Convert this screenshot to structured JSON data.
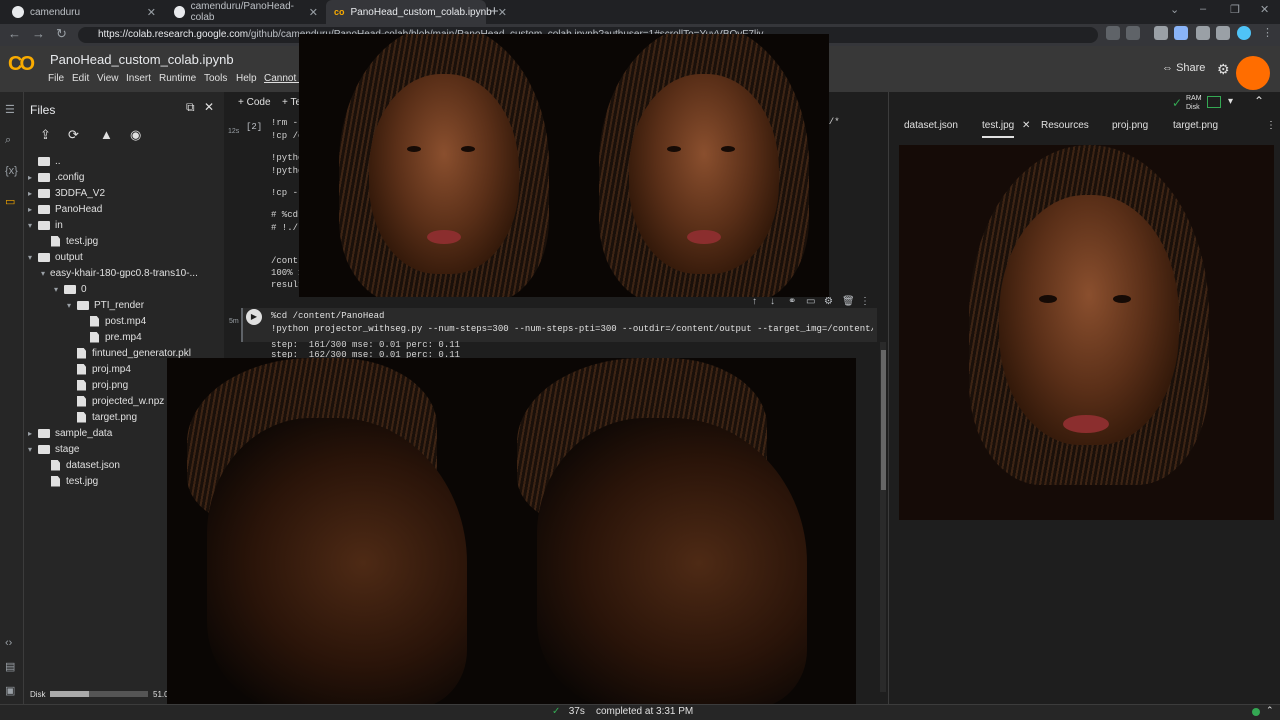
{
  "browser": {
    "tabs": [
      {
        "label": "camenduru"
      },
      {
        "label": "camenduru/PanoHead-colab"
      },
      {
        "label": "PanoHead_custom_colab.ipynb"
      }
    ],
    "url_host": "https://colab.research.google.com",
    "url_path": "/github/camenduru/PanoHead-colab/blob/main/PanoHead_custom_colab.ipynb?authuser=1#scrollTo=YuvVBOvF7liv"
  },
  "colab": {
    "title": "PanoHead_custom_colab.ipynb",
    "menu": [
      "File",
      "Edit",
      "View",
      "Insert",
      "Runtime",
      "Tools",
      "Help",
      "Cannot save changes"
    ],
    "share_label": "Share",
    "add_code": "+ Code",
    "add_text": "+ Text",
    "ram_label": "RAM",
    "disk_label": "Disk"
  },
  "files_panel": {
    "title": "Files",
    "tree": [
      {
        "label": "..",
        "type": "folder",
        "depth": 0,
        "arrow": ""
      },
      {
        "label": ".config",
        "type": "folder",
        "depth": 0,
        "arrow": "▸"
      },
      {
        "label": "3DDFA_V2",
        "type": "folder",
        "depth": 0,
        "arrow": "▸"
      },
      {
        "label": "PanoHead",
        "type": "folder",
        "depth": 0,
        "arrow": "▸"
      },
      {
        "label": "in",
        "type": "folder",
        "depth": 0,
        "arrow": "▾"
      },
      {
        "label": "test.jpg",
        "type": "file",
        "depth": 1,
        "arrow": ""
      },
      {
        "label": "output",
        "type": "folder",
        "depth": 0,
        "arrow": "▾"
      },
      {
        "label": "easy-khair-180-gpc0.8-trans10-...",
        "type": "folder",
        "depth": 1,
        "arrow": "▾"
      },
      {
        "label": "0",
        "type": "folder",
        "depth": 2,
        "arrow": "▾"
      },
      {
        "label": "PTI_render",
        "type": "folder",
        "depth": 3,
        "arrow": "▾"
      },
      {
        "label": "post.mp4",
        "type": "file",
        "depth": 4,
        "arrow": ""
      },
      {
        "label": "pre.mp4",
        "type": "file",
        "depth": 4,
        "arrow": ""
      },
      {
        "label": "fintuned_generator.pkl",
        "type": "file",
        "depth": 3,
        "arrow": ""
      },
      {
        "label": "proj.mp4",
        "type": "file",
        "depth": 3,
        "arrow": ""
      },
      {
        "label": "proj.png",
        "type": "file",
        "depth": 3,
        "arrow": ""
      },
      {
        "label": "projected_w.npz",
        "type": "file",
        "depth": 3,
        "arrow": ""
      },
      {
        "label": "target.png",
        "type": "file",
        "depth": 3,
        "arrow": ""
      },
      {
        "label": "sample_data",
        "type": "folder",
        "depth": 0,
        "arrow": "▸"
      },
      {
        "label": "stage",
        "type": "folder",
        "depth": 0,
        "arrow": "▾"
      },
      {
        "label": "dataset.json",
        "type": "file",
        "depth": 1,
        "arrow": ""
      },
      {
        "label": "test.jpg",
        "type": "file",
        "depth": 1,
        "arrow": ""
      }
    ],
    "disk_label": "Disk",
    "disk_value": "51.0",
    "disk_fraction": 0.4
  },
  "cell1": {
    "exec_count": "[2]",
    "time": "12s",
    "lines": [
      "!rm -",
      "!cp /c",
      "",
      "!pytho",
      "!pytho",
      "",
      "!cp -r",
      "",
      "# %cd",
      "# !./"
    ],
    "line_tail": "ut/*",
    "output": [
      "/cont",
      "100% 1",
      "result"
    ]
  },
  "cell2": {
    "time": "5m",
    "line1": "%cd /content/PanoHead",
    "line2": "!python projector_withseg.py --num-steps=300 --num-steps-pti=300 --outdir=/content/output --target_img=/content/stage",
    "output": [
      "step:  161/300 mse: 0.01 perc: 0.11",
      "step:  162/300 mse: 0.01 perc: 0.11"
    ]
  },
  "right_panel": {
    "tabs": [
      "dataset.json",
      "test.jpg",
      "Resources",
      "proj.png",
      "target.png"
    ],
    "active_tab": "test.jpg"
  },
  "status": {
    "duration": "37s",
    "text": "completed at 3:31 PM"
  }
}
